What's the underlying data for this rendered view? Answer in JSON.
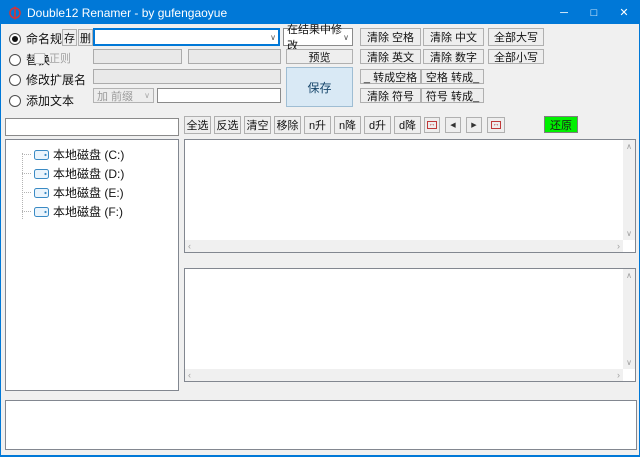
{
  "window": {
    "title": "Double12 Renamer - by gufengaoyue",
    "minimize": "─",
    "maximize": "□",
    "close": "✕"
  },
  "rules": {
    "naming": {
      "label": "命名规则",
      "store": "存",
      "delete": "删"
    },
    "replace": {
      "label": "替换",
      "regex": "正则"
    },
    "extension": {
      "label": "修改扩展名"
    },
    "addtext": {
      "label": "添加文本",
      "mode": "加 前缀"
    }
  },
  "actions": {
    "result_mode": "在结果中修改",
    "preview": "预览",
    "save": "保存",
    "clear_space": "清除 空格",
    "clear_english": "清除 英文",
    "underscore_to_space": "_ 转成空格",
    "clear_symbol": "清除 符号",
    "clear_chinese": "清除 中文",
    "clear_digits": "清除 数字",
    "space_to_underscore": "空格 转成_",
    "symbol_to_underscore": "符号 转成_",
    "uppercase": "全部大写",
    "lowercase": "全部小写"
  },
  "toolbar": {
    "select_all": "全选",
    "invert": "反选",
    "clear": "清空",
    "remove": "移除",
    "n_asc": "n升",
    "n_desc": "n降",
    "d_asc": "d升",
    "d_desc": "d降",
    "arrow_left": "◀",
    "arrow_right": "▶",
    "red_arrows": "↔",
    "restore": "还原",
    "restore_color": "#00f000"
  },
  "icons": {
    "up": "∧",
    "down": "∨",
    "left": "‹",
    "right": "›",
    "chevron": "∨"
  },
  "drives": {
    "items": [
      "本地磁盘 (C:)",
      "本地磁盘 (D:)",
      "本地磁盘 (E:)",
      "本地磁盘 (F:)"
    ]
  },
  "colors": {
    "titlebar": "#0078d7",
    "save_button_bg": "#d9e9f5",
    "restore_button_bg": "#00f000"
  }
}
